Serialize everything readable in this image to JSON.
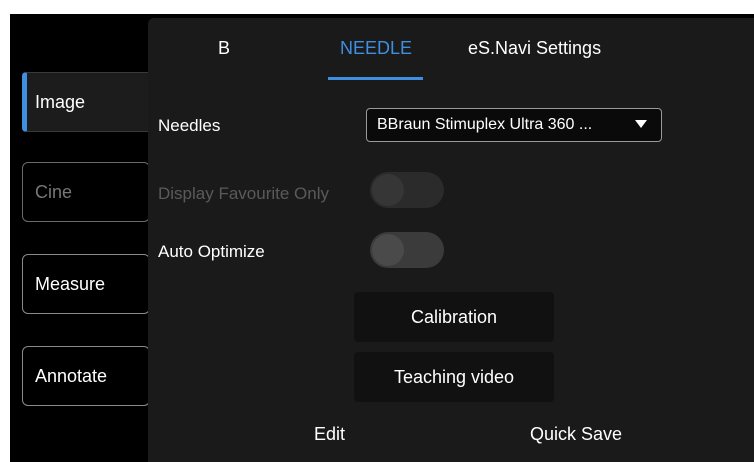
{
  "sidebar": {
    "items": [
      {
        "label": "Image",
        "state": "active"
      },
      {
        "label": "Cine",
        "state": "disabled"
      },
      {
        "label": "Measure",
        "state": "normal"
      },
      {
        "label": "Annotate",
        "state": "normal"
      }
    ]
  },
  "tabs": [
    {
      "label": "B"
    },
    {
      "label": "NEEDLE",
      "active": true
    },
    {
      "label": "eS.Navi Settings"
    }
  ],
  "settings": {
    "needles_label": "Needles",
    "needles_value": "BBraun Stimuplex Ultra 360 ...",
    "display_favourite_label": "Display Favourite Only",
    "display_favourite_on": false,
    "auto_optimize_label": "Auto Optimize",
    "auto_optimize_on": false
  },
  "actions": {
    "calibration": "Calibration",
    "teaching_video": "Teaching video"
  },
  "footer": {
    "edit": "Edit",
    "quick_save": "Quick Save"
  },
  "colors": {
    "accent": "#3f8fe0",
    "panel": "#1a1a1a",
    "background": "#000000"
  }
}
